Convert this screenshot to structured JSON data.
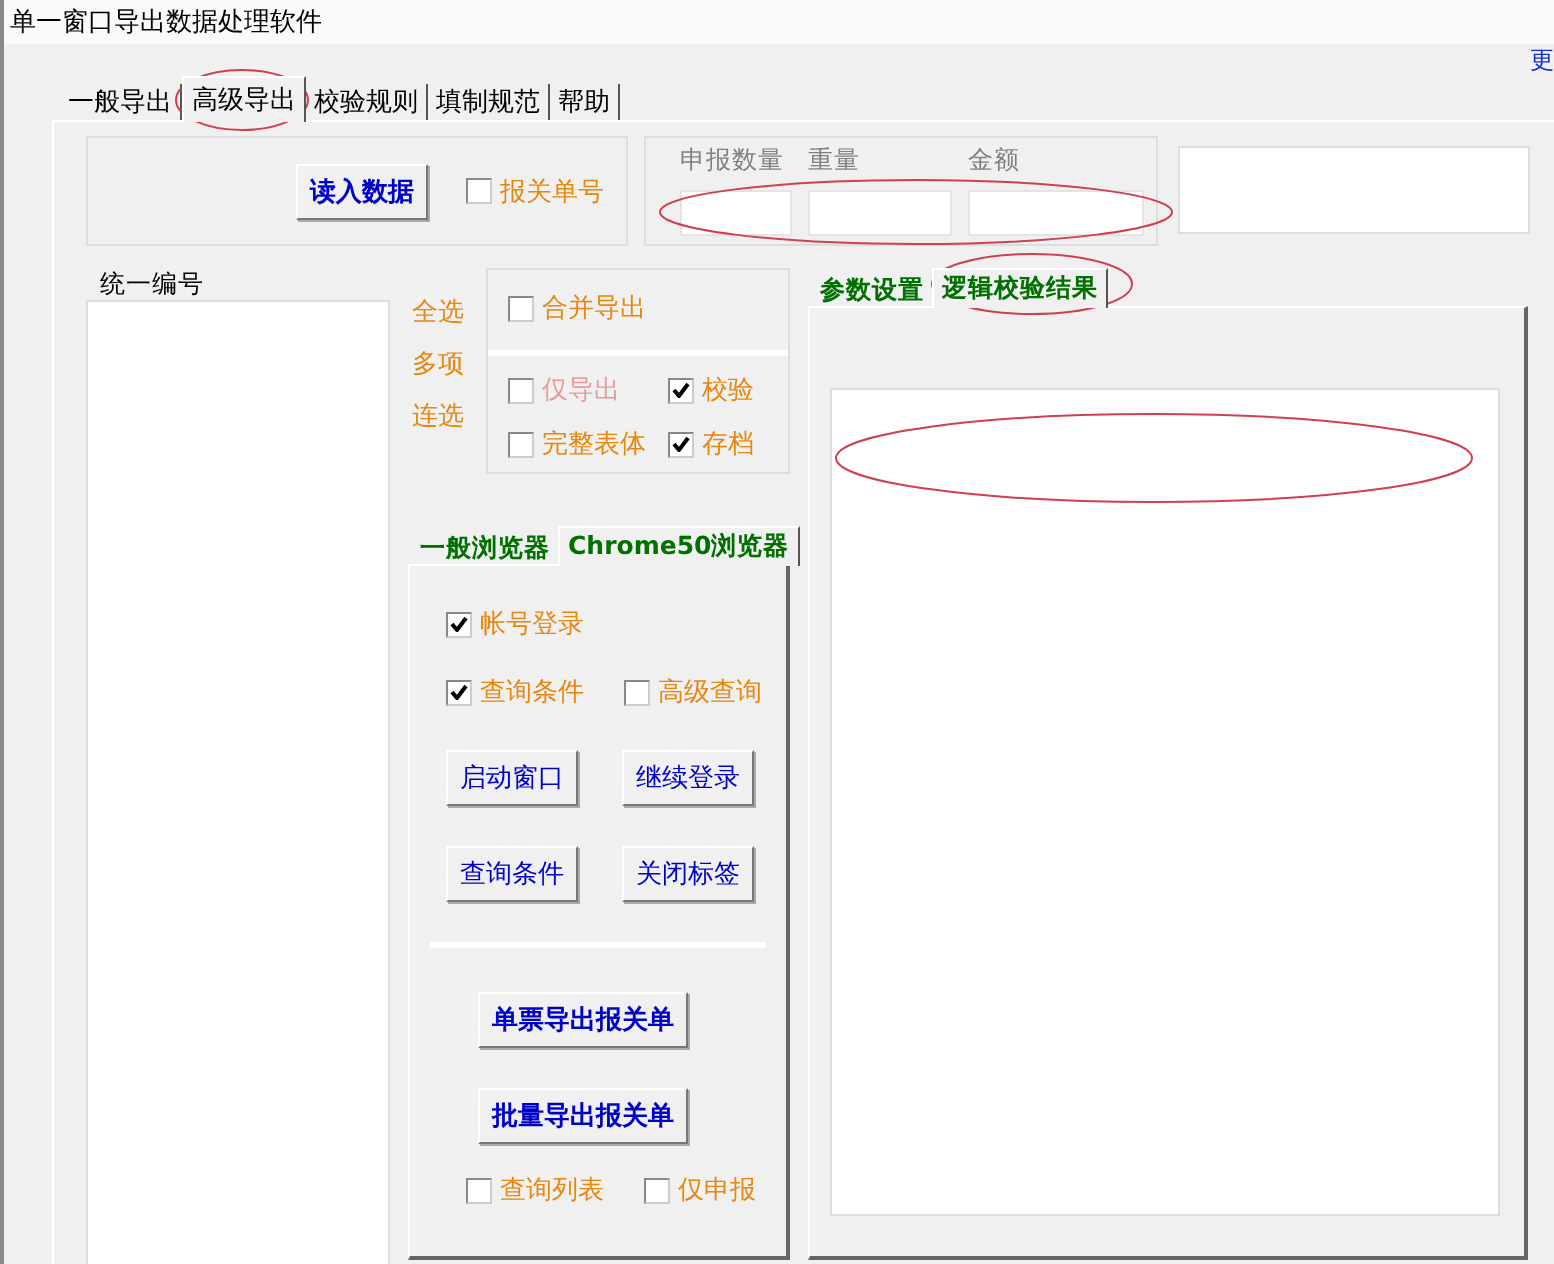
{
  "window": {
    "title": "单一窗口导出数据处理软件"
  },
  "corner_link": "更",
  "tabs": [
    {
      "label": "一般导出",
      "selected": false
    },
    {
      "label": "高级导出",
      "selected": true
    },
    {
      "label": "校验规则",
      "selected": false
    },
    {
      "label": "填制规范",
      "selected": false
    },
    {
      "label": "帮助",
      "selected": false
    }
  ],
  "read_button": {
    "label": "读入数据",
    "emphasis": true
  },
  "declaration_checkbox": {
    "label": "报关单号",
    "checked": false,
    "disabled": false
  },
  "totals": [
    {
      "label": "申报数量"
    },
    {
      "label": "重量"
    },
    {
      "label": "金额"
    }
  ],
  "list": {
    "label": "统一编号"
  },
  "select_modes": [
    "全选",
    "多项",
    "连选"
  ],
  "merge_checkbox": {
    "label": "合并导出",
    "checked": false,
    "disabled": false
  },
  "options": [
    {
      "label": "仅导出",
      "checked": false,
      "disabled": true
    },
    {
      "label": "校验",
      "checked": true,
      "disabled": false
    },
    {
      "label": "完整表体",
      "checked": false,
      "disabled": false
    },
    {
      "label": "存档",
      "checked": true,
      "disabled": false
    }
  ],
  "browser_tabs": [
    {
      "label": "一般浏览器",
      "selected": false
    },
    {
      "label": "Chrome50浏览器",
      "selected": true
    }
  ],
  "browser_checks": [
    {
      "label": "帐号登录",
      "checked": true,
      "disabled": false
    },
    {
      "label": "查询条件",
      "checked": true,
      "disabled": false
    },
    {
      "label": "高级查询",
      "checked": false,
      "disabled": false
    }
  ],
  "browser_buttons": [
    {
      "label": "启动窗口",
      "emphasis": false
    },
    {
      "label": "继续登录",
      "emphasis": false
    },
    {
      "label": "查询条件",
      "emphasis": false
    },
    {
      "label": "关闭标签",
      "emphasis": false
    }
  ],
  "export_buttons": [
    {
      "label": "单票导出报关单",
      "emphasis": true
    },
    {
      "label": "批量导出报关单",
      "emphasis": true
    }
  ],
  "bottom_checks": [
    {
      "label": "查询列表",
      "checked": false,
      "disabled": false
    },
    {
      "label": "仅申报",
      "checked": false,
      "disabled": false
    }
  ],
  "result_tabs": [
    {
      "label": "参数设置",
      "selected": false
    },
    {
      "label": "逻辑校验结果",
      "selected": true
    }
  ]
}
